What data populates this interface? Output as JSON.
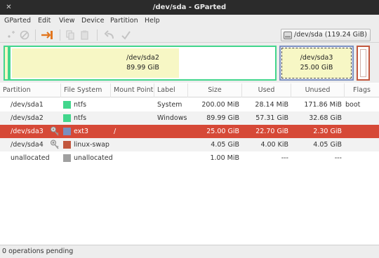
{
  "window": {
    "title": "/dev/sda - GParted"
  },
  "menubar": {
    "items": [
      "GParted",
      "Edit",
      "View",
      "Device",
      "Partition",
      "Help"
    ]
  },
  "toolbar": {
    "icons": [
      "new-icon",
      "delete-icon",
      "resize-move-icon",
      "copy-icon",
      "paste-icon",
      "undo-icon",
      "apply-icon"
    ],
    "device_selector": "/dev/sda  (119.24 GiB)"
  },
  "disk_map": {
    "partitions": [
      {
        "name": "/dev/sda2",
        "size": "89.99 GiB"
      },
      {
        "name": "/dev/sda3",
        "size": "25.00 GiB"
      }
    ]
  },
  "table": {
    "columns": [
      "Partition",
      "File System",
      "Mount Point",
      "Label",
      "Size",
      "Used",
      "Unused",
      "Flags"
    ],
    "rows": [
      {
        "partition": "/dev/sda1",
        "fs": "ntfs",
        "fs_color": "#42d68c",
        "mount": "",
        "label": "System",
        "size": "200.00 MiB",
        "used": "28.14 MiB",
        "unused": "171.86 MiB",
        "flags": "boot",
        "key": false
      },
      {
        "partition": "/dev/sda2",
        "fs": "ntfs",
        "fs_color": "#42d68c",
        "mount": "",
        "label": "Windows",
        "size": "89.99 GiB",
        "used": "57.31 GiB",
        "unused": "32.68 GiB",
        "flags": "",
        "key": false
      },
      {
        "partition": "/dev/sda3",
        "fs": "ext3",
        "fs_color": "#7a8fc0",
        "mount": "/",
        "label": "",
        "size": "25.00 GiB",
        "used": "22.70 GiB",
        "unused": "2.30 GiB",
        "flags": "",
        "key": true
      },
      {
        "partition": "/dev/sda4",
        "fs": "linux-swap",
        "fs_color": "#c2573e",
        "mount": "",
        "label": "",
        "size": "4.05 GiB",
        "used": "4.00 KiB",
        "unused": "4.05 GiB",
        "flags": "",
        "key": true
      },
      {
        "partition": "unallocated",
        "fs": "unallocated",
        "fs_color": "#a0a0a0",
        "mount": "",
        "label": "",
        "size": "1.00 MiB",
        "used": "---",
        "unused": "---",
        "flags": "",
        "key": false
      }
    ]
  },
  "status": {
    "text": "0 operations pending"
  },
  "colors": {
    "selection": "#d64937",
    "ntfs": "#42d68c",
    "ext3": "#7a8fc0",
    "swap": "#c2573e",
    "used_fill": "#f7f7c5"
  }
}
